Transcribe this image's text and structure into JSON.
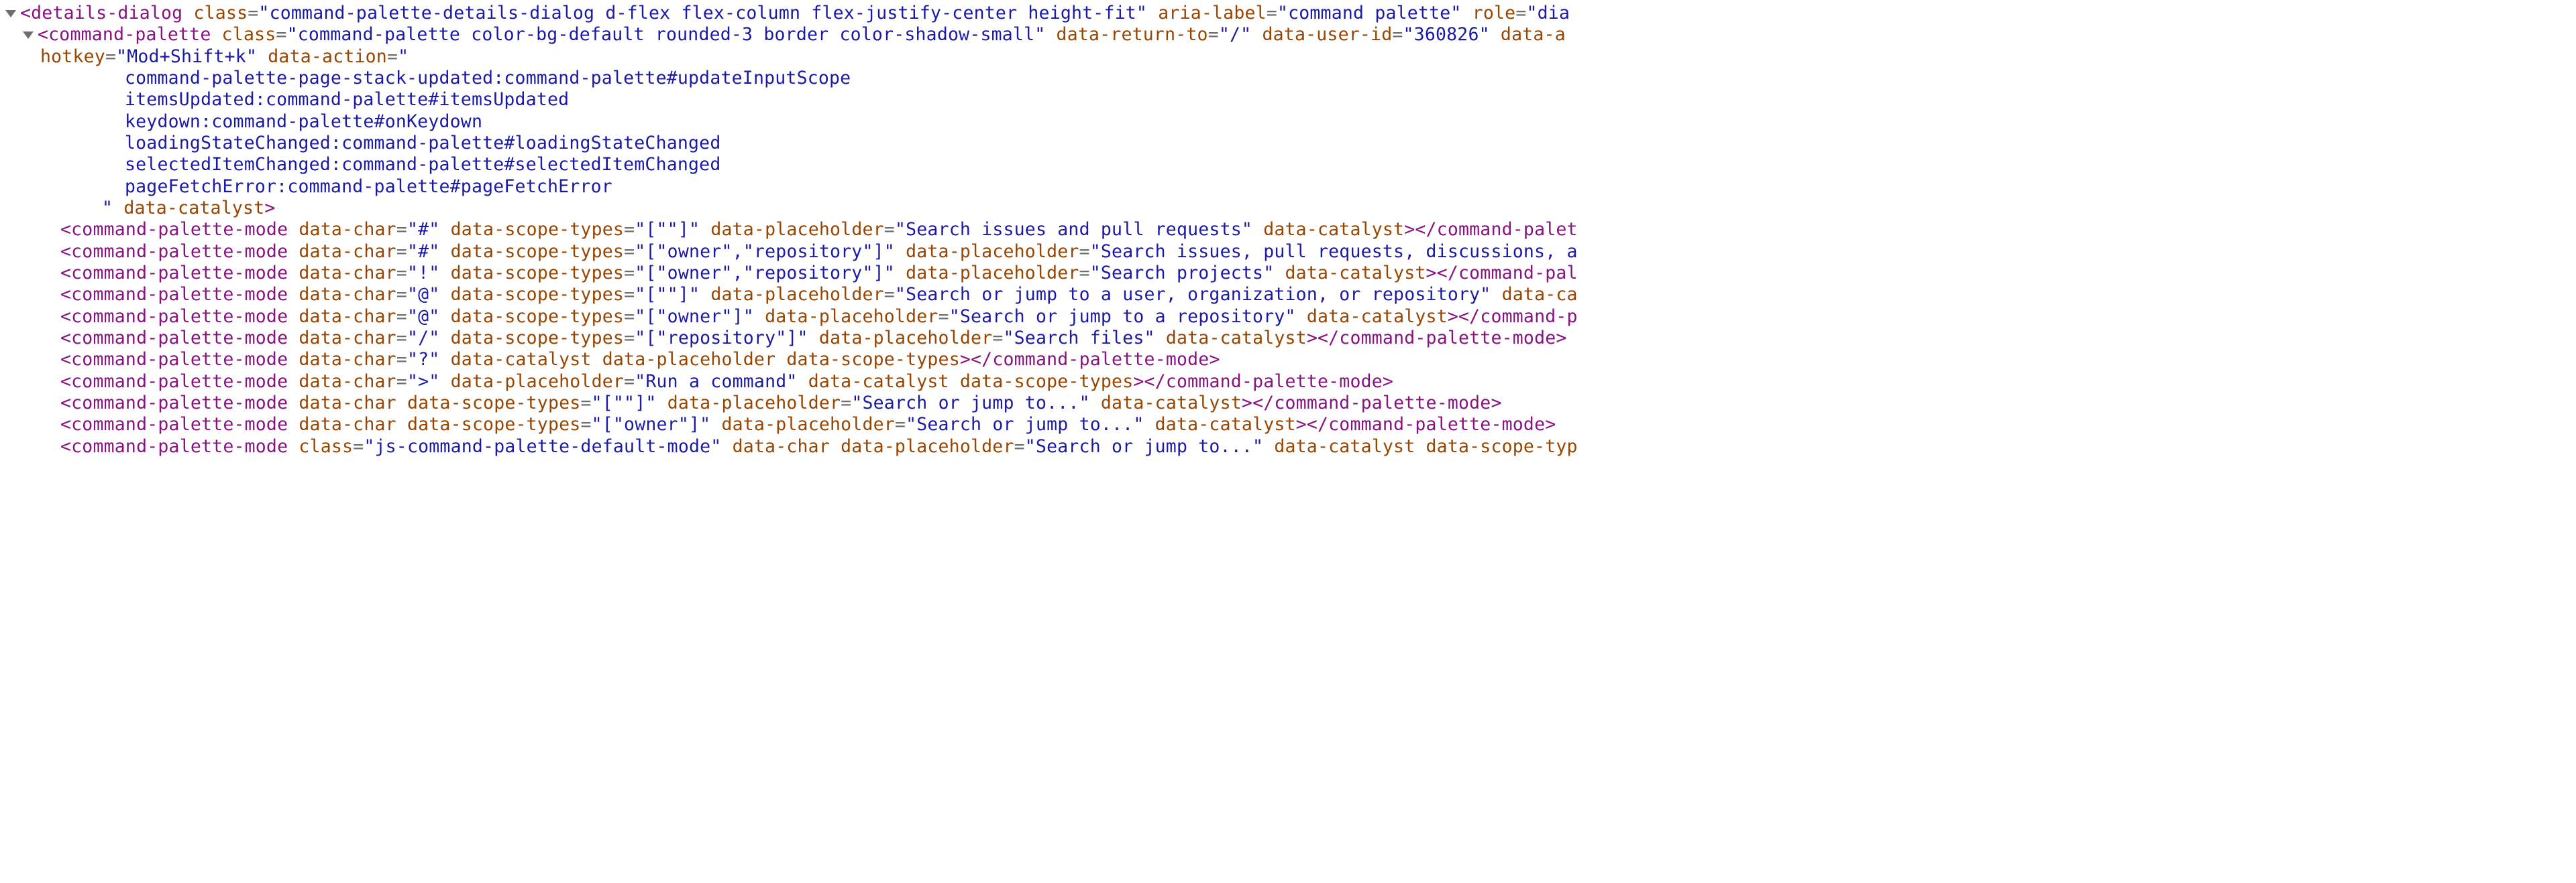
{
  "line1": {
    "tag": "details-dialog",
    "attrs": [
      {
        "n": "class",
        "v": "command-palette-details-dialog d-flex flex-column flex-justify-center height-fit"
      },
      {
        "n": "aria-label",
        "v": "command palette"
      },
      {
        "n": "role",
        "v": "dia",
        "cut": true
      }
    ]
  },
  "line2": {
    "tag": "command-palette",
    "attrs": [
      {
        "n": "class",
        "v": "command-palette color-bg-default rounded-3 border color-shadow-small"
      },
      {
        "n": "data-return-to",
        "v": "/"
      },
      {
        "n": "data-user-id",
        "v": "360826"
      }
    ],
    "trail": {
      "n": "data-a",
      "cut": true
    }
  },
  "line3_leadAttr": {
    "n": "hotkey",
    "v": "Mod+Shift+k"
  },
  "line3_attr2": {
    "n": "data-action",
    "v_open": "\""
  },
  "actionLines": [
    "command-palette-page-stack-updated:command-palette#updateInputScope",
    "itemsUpdated:command-palette#itemsUpdated",
    "keydown:command-palette#onKeydown",
    "loadingStateChanged:command-palette#loadingStateChanged",
    "selectedItemChanged:command-palette#selectedItemChanged",
    "pageFetchError:command-palette#pageFetchError"
  ],
  "line_close_action": {
    "quote": "\"",
    "attr": "data-catalyst"
  },
  "modes": [
    {
      "attrs": [
        {
          "n": "data-char",
          "v": "#"
        },
        {
          "n": "data-scope-types",
          "v": "[\"\"]"
        },
        {
          "n": "data-placeholder",
          "v": "Search issues and pull requests"
        },
        {
          "n": "data-catalyst",
          "bare": true
        }
      ],
      "close": "command-palet",
      "cut": true
    },
    {
      "attrs": [
        {
          "n": "data-char",
          "v": "#"
        },
        {
          "n": "data-scope-types",
          "v": "[\"owner\",\"repository\"]"
        },
        {
          "n": "data-placeholder",
          "v": "Search issues, pull requests, discussions, a",
          "cut": true
        }
      ]
    },
    {
      "attrs": [
        {
          "n": "data-char",
          "v": "!"
        },
        {
          "n": "data-scope-types",
          "v": "[\"owner\",\"repository\"]"
        },
        {
          "n": "data-placeholder",
          "v": "Search projects"
        },
        {
          "n": "data-catalyst",
          "bare": true
        }
      ],
      "close": "command-pal",
      "cut": true
    },
    {
      "attrs": [
        {
          "n": "data-char",
          "v": "@"
        },
        {
          "n": "data-scope-types",
          "v": "[\"\"]"
        },
        {
          "n": "data-placeholder",
          "v": "Search or jump to a user, organization, or repository"
        }
      ],
      "trail": {
        "n": "data-ca",
        "cut": true
      }
    },
    {
      "attrs": [
        {
          "n": "data-char",
          "v": "@"
        },
        {
          "n": "data-scope-types",
          "v": "[\"owner\"]"
        },
        {
          "n": "data-placeholder",
          "v": "Search or jump to a repository"
        },
        {
          "n": "data-catalyst",
          "bare": true
        }
      ],
      "close": "command-p",
      "cut": true
    },
    {
      "attrs": [
        {
          "n": "data-char",
          "v": "/"
        },
        {
          "n": "data-scope-types",
          "v": "[\"repository\"]"
        },
        {
          "n": "data-placeholder",
          "v": "Search files"
        },
        {
          "n": "data-catalyst",
          "bare": true
        }
      ],
      "close": "command-palette-mode",
      "cut": false
    },
    {
      "attrs": [
        {
          "n": "data-char",
          "v": "?"
        },
        {
          "n": "data-catalyst",
          "bare": true
        },
        {
          "n": "data-placeholder",
          "bare": true
        },
        {
          "n": "data-scope-types",
          "bare": true
        }
      ],
      "close": "command-palette-mode",
      "cut": false
    },
    {
      "attrs": [
        {
          "n": "data-char",
          "v": ">"
        },
        {
          "n": "data-placeholder",
          "v": "Run a command"
        },
        {
          "n": "data-catalyst",
          "bare": true
        },
        {
          "n": "data-scope-types",
          "bare": true
        }
      ],
      "close": "command-palette-mode",
      "cut": false
    },
    {
      "attrs": [
        {
          "n": "data-char",
          "bare": true
        },
        {
          "n": "data-scope-types",
          "v": "[\"\"]"
        },
        {
          "n": "data-placeholder",
          "v": "Search or jump to..."
        },
        {
          "n": "data-catalyst",
          "bare": true
        }
      ],
      "close": "command-palette-mode",
      "cut": false
    },
    {
      "attrs": [
        {
          "n": "data-char",
          "bare": true
        },
        {
          "n": "data-scope-types",
          "v": "[\"owner\"]"
        },
        {
          "n": "data-placeholder",
          "v": "Search or jump to..."
        },
        {
          "n": "data-catalyst",
          "bare": true
        }
      ],
      "close": "command-palette-mode",
      "cut": false
    },
    {
      "attrs": [
        {
          "n": "class",
          "v": "js-command-palette-default-mode"
        },
        {
          "n": "data-char",
          "bare": true
        },
        {
          "n": "data-placeholder",
          "v": "Search or jump to..."
        },
        {
          "n": "data-catalyst",
          "bare": true
        }
      ],
      "trail": {
        "n": "data-scope-typ",
        "cut": true
      }
    }
  ],
  "modeTag": "command-palette-mode"
}
